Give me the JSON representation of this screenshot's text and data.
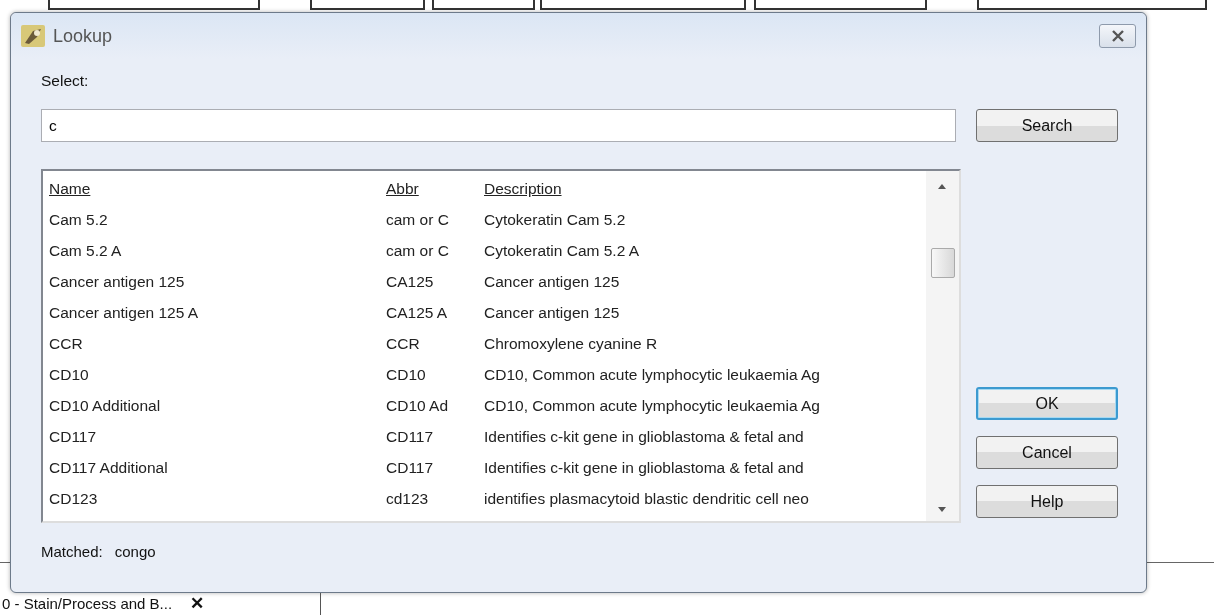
{
  "window": {
    "title": "Lookup"
  },
  "select_label": "Select:",
  "search": {
    "value": "c",
    "button": "Search"
  },
  "table": {
    "columns": [
      "Name",
      "Abbr",
      "Description"
    ],
    "rows": [
      {
        "name": "Cam 5.2",
        "abbr": "cam or C",
        "description": "Cytokeratin Cam 5.2"
      },
      {
        "name": "Cam 5.2 A",
        "abbr": "cam or C",
        "description": "Cytokeratin Cam 5.2 A"
      },
      {
        "name": "Cancer antigen 125",
        "abbr": "CA125",
        "description": "Cancer antigen 125"
      },
      {
        "name": "Cancer antigen 125 A",
        "abbr": "CA125 A",
        "description": "Cancer antigen 125"
      },
      {
        "name": "CCR",
        "abbr": "CCR",
        "description": "Chromoxylene cyanine R"
      },
      {
        "name": "CD10",
        "abbr": "CD10",
        "description": "CD10, Common acute lymphocytic leukaemia Ag"
      },
      {
        "name": "CD10 Additional",
        "abbr": "CD10 Ad",
        "description": "CD10, Common acute lymphocytic leukaemia Ag"
      },
      {
        "name": "CD117",
        "abbr": "CD117",
        "description": "Identifies c-kit gene in glioblastoma & fetal and"
      },
      {
        "name": "CD117 Additional",
        "abbr": "CD117",
        "description": "Identifies c-kit gene in glioblastoma & fetal and"
      },
      {
        "name": "CD123",
        "abbr": "cd123",
        "description": "identifies plasmacytoid blastic dendritic cell neo"
      }
    ]
  },
  "buttons": [
    {
      "label": "OK",
      "default": true
    },
    {
      "label": "Cancel",
      "default": false
    },
    {
      "label": "Help",
      "default": false
    }
  ],
  "matched": {
    "label": "Matched:",
    "value": "congo"
  },
  "background_tab": {
    "label": "0 - Stain/Process and B...",
    "close": "✕"
  }
}
